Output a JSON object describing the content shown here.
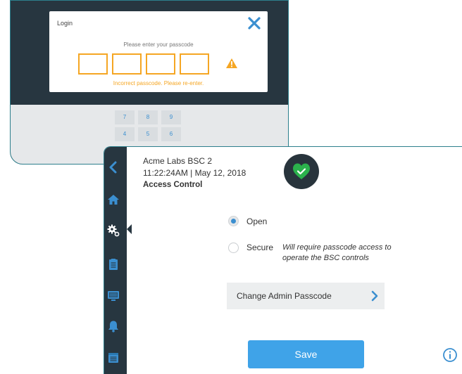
{
  "login": {
    "title": "Login",
    "prompt": "Please enter your passcode",
    "error": "Incorrect passcode. Please re-enter.",
    "close_icon": "close-icon",
    "warning_icon": "warning-icon",
    "keypad": [
      "7",
      "8",
      "9",
      "4",
      "5",
      "6"
    ]
  },
  "main": {
    "device_name": "Acme Labs BSC 2",
    "datetime": "11:22:24AM | May 12, 2018",
    "section_title": "Access Control",
    "options": {
      "open": "Open",
      "secure": "Secure",
      "secure_description": "Will require passcode access to operate the BSC controls",
      "selected": "open"
    },
    "change_passcode_label": "Change Admin Passcode",
    "save_label": "Save"
  },
  "sidebar": {
    "icons": [
      "back-icon",
      "home-icon",
      "settings-icon",
      "clipboard-icon",
      "monitor-icon",
      "bell-icon",
      "calendar-icon"
    ]
  },
  "colors": {
    "accent": "#3FA3E8",
    "warning": "#F5A623",
    "sidebar": "#273640",
    "status_ok": "#2BB24C"
  }
}
